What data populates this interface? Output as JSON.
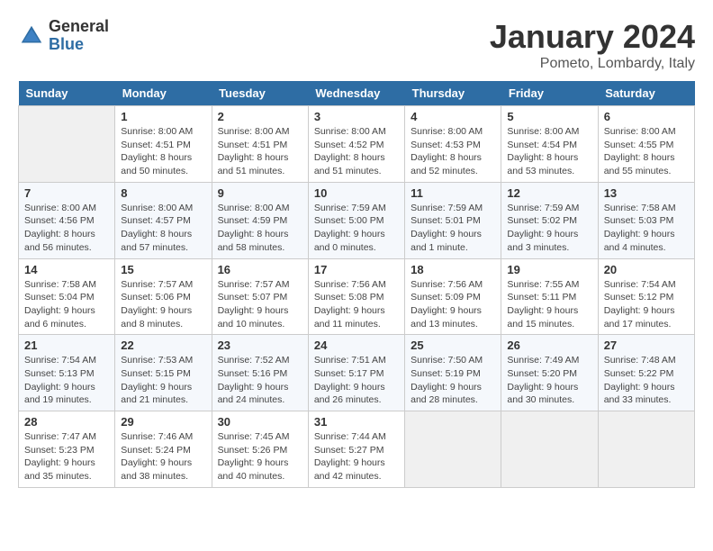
{
  "header": {
    "logo_general": "General",
    "logo_blue": "Blue",
    "title": "January 2024",
    "subtitle": "Pometo, Lombardy, Italy"
  },
  "days_of_week": [
    "Sunday",
    "Monday",
    "Tuesday",
    "Wednesday",
    "Thursday",
    "Friday",
    "Saturday"
  ],
  "weeks": [
    [
      {
        "day": "",
        "info": ""
      },
      {
        "day": "1",
        "info": "Sunrise: 8:00 AM\nSunset: 4:51 PM\nDaylight: 8 hours\nand 50 minutes."
      },
      {
        "day": "2",
        "info": "Sunrise: 8:00 AM\nSunset: 4:51 PM\nDaylight: 8 hours\nand 51 minutes."
      },
      {
        "day": "3",
        "info": "Sunrise: 8:00 AM\nSunset: 4:52 PM\nDaylight: 8 hours\nand 51 minutes."
      },
      {
        "day": "4",
        "info": "Sunrise: 8:00 AM\nSunset: 4:53 PM\nDaylight: 8 hours\nand 52 minutes."
      },
      {
        "day": "5",
        "info": "Sunrise: 8:00 AM\nSunset: 4:54 PM\nDaylight: 8 hours\nand 53 minutes."
      },
      {
        "day": "6",
        "info": "Sunrise: 8:00 AM\nSunset: 4:55 PM\nDaylight: 8 hours\nand 55 minutes."
      }
    ],
    [
      {
        "day": "7",
        "info": "Sunrise: 8:00 AM\nSunset: 4:56 PM\nDaylight: 8 hours\nand 56 minutes."
      },
      {
        "day": "8",
        "info": "Sunrise: 8:00 AM\nSunset: 4:57 PM\nDaylight: 8 hours\nand 57 minutes."
      },
      {
        "day": "9",
        "info": "Sunrise: 8:00 AM\nSunset: 4:59 PM\nDaylight: 8 hours\nand 58 minutes."
      },
      {
        "day": "10",
        "info": "Sunrise: 7:59 AM\nSunset: 5:00 PM\nDaylight: 9 hours\nand 0 minutes."
      },
      {
        "day": "11",
        "info": "Sunrise: 7:59 AM\nSunset: 5:01 PM\nDaylight: 9 hours\nand 1 minute."
      },
      {
        "day": "12",
        "info": "Sunrise: 7:59 AM\nSunset: 5:02 PM\nDaylight: 9 hours\nand 3 minutes."
      },
      {
        "day": "13",
        "info": "Sunrise: 7:58 AM\nSunset: 5:03 PM\nDaylight: 9 hours\nand 4 minutes."
      }
    ],
    [
      {
        "day": "14",
        "info": "Sunrise: 7:58 AM\nSunset: 5:04 PM\nDaylight: 9 hours\nand 6 minutes."
      },
      {
        "day": "15",
        "info": "Sunrise: 7:57 AM\nSunset: 5:06 PM\nDaylight: 9 hours\nand 8 minutes."
      },
      {
        "day": "16",
        "info": "Sunrise: 7:57 AM\nSunset: 5:07 PM\nDaylight: 9 hours\nand 10 minutes."
      },
      {
        "day": "17",
        "info": "Sunrise: 7:56 AM\nSunset: 5:08 PM\nDaylight: 9 hours\nand 11 minutes."
      },
      {
        "day": "18",
        "info": "Sunrise: 7:56 AM\nSunset: 5:09 PM\nDaylight: 9 hours\nand 13 minutes."
      },
      {
        "day": "19",
        "info": "Sunrise: 7:55 AM\nSunset: 5:11 PM\nDaylight: 9 hours\nand 15 minutes."
      },
      {
        "day": "20",
        "info": "Sunrise: 7:54 AM\nSunset: 5:12 PM\nDaylight: 9 hours\nand 17 minutes."
      }
    ],
    [
      {
        "day": "21",
        "info": "Sunrise: 7:54 AM\nSunset: 5:13 PM\nDaylight: 9 hours\nand 19 minutes."
      },
      {
        "day": "22",
        "info": "Sunrise: 7:53 AM\nSunset: 5:15 PM\nDaylight: 9 hours\nand 21 minutes."
      },
      {
        "day": "23",
        "info": "Sunrise: 7:52 AM\nSunset: 5:16 PM\nDaylight: 9 hours\nand 24 minutes."
      },
      {
        "day": "24",
        "info": "Sunrise: 7:51 AM\nSunset: 5:17 PM\nDaylight: 9 hours\nand 26 minutes."
      },
      {
        "day": "25",
        "info": "Sunrise: 7:50 AM\nSunset: 5:19 PM\nDaylight: 9 hours\nand 28 minutes."
      },
      {
        "day": "26",
        "info": "Sunrise: 7:49 AM\nSunset: 5:20 PM\nDaylight: 9 hours\nand 30 minutes."
      },
      {
        "day": "27",
        "info": "Sunrise: 7:48 AM\nSunset: 5:22 PM\nDaylight: 9 hours\nand 33 minutes."
      }
    ],
    [
      {
        "day": "28",
        "info": "Sunrise: 7:47 AM\nSunset: 5:23 PM\nDaylight: 9 hours\nand 35 minutes."
      },
      {
        "day": "29",
        "info": "Sunrise: 7:46 AM\nSunset: 5:24 PM\nDaylight: 9 hours\nand 38 minutes."
      },
      {
        "day": "30",
        "info": "Sunrise: 7:45 AM\nSunset: 5:26 PM\nDaylight: 9 hours\nand 40 minutes."
      },
      {
        "day": "31",
        "info": "Sunrise: 7:44 AM\nSunset: 5:27 PM\nDaylight: 9 hours\nand 42 minutes."
      },
      {
        "day": "",
        "info": ""
      },
      {
        "day": "",
        "info": ""
      },
      {
        "day": "",
        "info": ""
      }
    ]
  ]
}
